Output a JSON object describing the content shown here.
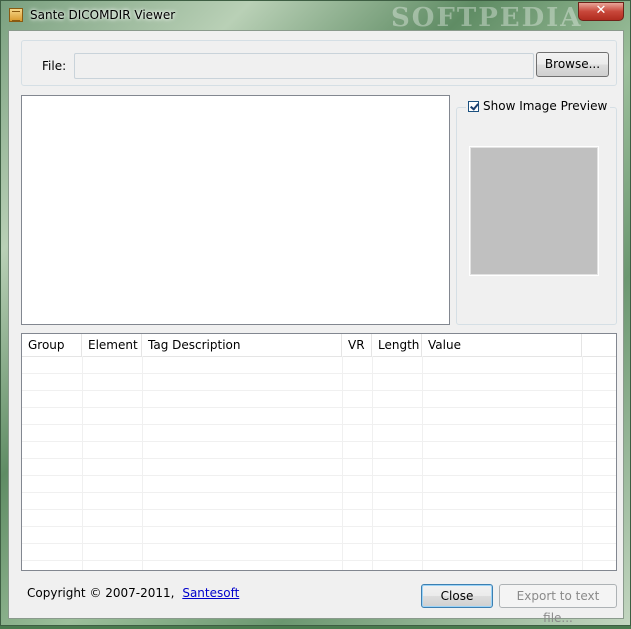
{
  "window": {
    "title": "Sante DICOMDIR Viewer",
    "watermark": "SOFTPEDIA",
    "close_glyph": "✕"
  },
  "file": {
    "label": "File:",
    "value": "",
    "browse_label": "Browse..."
  },
  "preview": {
    "checkbox_label": "Show Image Preview",
    "checked": true
  },
  "table": {
    "columns": [
      "Group",
      "Element",
      "Tag Description",
      "VR",
      "Length",
      "Value"
    ],
    "rows": []
  },
  "footer": {
    "copyright": "Copyright © 2007-2011,",
    "link": "Santesoft",
    "close_label": "Close",
    "export_label": "Export to text file..."
  },
  "colors": {
    "accent": "#3c7fb1",
    "link": "#0000cc",
    "preview_placeholder": "#c0c0c0"
  }
}
